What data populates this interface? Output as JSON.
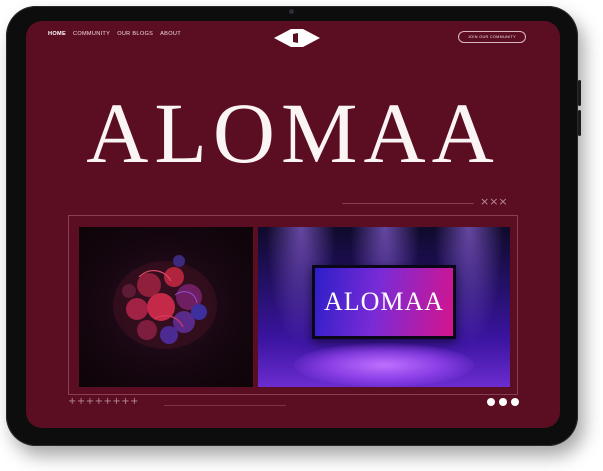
{
  "nav": {
    "items": [
      "HOME",
      "COMMUNITY",
      "OUR BLOGS",
      "ABOUT"
    ],
    "active": "HOME"
  },
  "header": {
    "join_label": "JOIN OUR COMMUNITY"
  },
  "hero": {
    "title": "ALOMAA"
  },
  "showcase": {
    "screen_text": "ALOMAA"
  },
  "decor": {
    "crosses": "×××",
    "pluses": "++++++++"
  },
  "colors": {
    "background": "#5b0e22",
    "text": "#fbf4f5",
    "device": "#0d0d0e"
  },
  "carousel": {
    "pages": 3,
    "current": 1
  }
}
